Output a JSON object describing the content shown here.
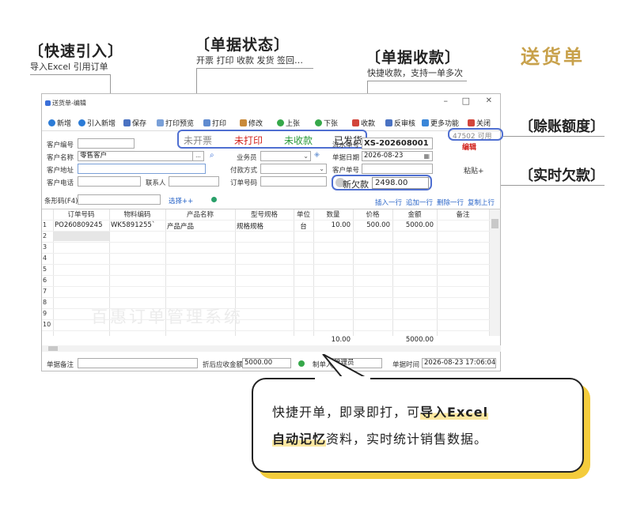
{
  "brand": "送货单",
  "features": {
    "quick_import": {
      "title": "〔快速引入〕",
      "desc": "导入Excel 引用订单"
    },
    "doc_status": {
      "title": "〔单据状态〕",
      "desc": "开票 打印 收款 发货 签回…"
    },
    "doc_collect": {
      "title": "〔单据收款〕",
      "desc": "快捷收款，支持一单多次"
    },
    "credit_limit": "〔赊账额度〕",
    "current_debt": "〔实时欠款〕"
  },
  "window": {
    "title": "送货单-编辑",
    "controls": {
      "minimize": "–",
      "maximize": "□",
      "close": "✕"
    },
    "toolbar": [
      "新增",
      "引入新增",
      "保存",
      "打印预览",
      "打印",
      "修改",
      "上张",
      "下张",
      "收款",
      "反审核",
      "更多功能",
      "关闭"
    ],
    "status": {
      "invoice": "未开票",
      "print": "未打印",
      "collect": "未收款",
      "ship": "已发货"
    },
    "credit": "47502 可用",
    "edit_tag": "编辑",
    "paste": "粘贴+",
    "form": {
      "customer_no_label": "客户编号",
      "customer_name_label": "客户名称",
      "customer_name": "零售客户",
      "ellipsis": "...",
      "customer_addr_label": "客户地址",
      "customer_phone_label": "客户电话",
      "contact_label": "联系人",
      "salesman_label": "业务员",
      "payment_label": "付款方式",
      "order_no_label": "订单号码",
      "serial_label": "流水单号",
      "serial": "XS-202608001",
      "date_label": "单据日期",
      "date": "2026-08-23",
      "cust_doc_label": "客户单号",
      "debt_label": "新欠款",
      "debt": "2498.00"
    },
    "barcode_label": "条形码(F4)",
    "select_label": "选择++",
    "row_actions": [
      "插入一行",
      "追加一行",
      "删除一行",
      "复制上行"
    ],
    "columns": [
      "订单号码",
      "物料编码",
      "产品名称",
      "型号规格",
      "单位",
      "数量",
      "价格",
      "金额",
      "备注"
    ],
    "rows": [
      {
        "n": "1",
        "order": "PO260809245",
        "code": "WK5891255`",
        "name": "产品产品",
        "spec": "规格规格",
        "unit": "台",
        "qty": "10.00",
        "price": "500.00",
        "amount": "5000.00",
        "note": ""
      }
    ],
    "row_numbers": [
      "1",
      "2",
      "3",
      "4",
      "5",
      "6",
      "7",
      "8",
      "9",
      "10"
    ],
    "totals": {
      "qty": "10.00",
      "amount": "5000.00"
    },
    "watermark": "百惠订单管理系统",
    "footer": {
      "note_label": "单据备注",
      "discount_label": "折后应收金额",
      "discount": "5000.00",
      "maker_label": "制单人",
      "maker": "管理员",
      "time_label": "单据时间",
      "time": "2026-08-23 17:06:04"
    }
  },
  "bubble": {
    "line1_a": "快捷开单，即录即打，可",
    "line1_b": "导入Excel",
    "line2_a": "自动记忆",
    "line2_b": "资料，实时统计销售数据。"
  }
}
